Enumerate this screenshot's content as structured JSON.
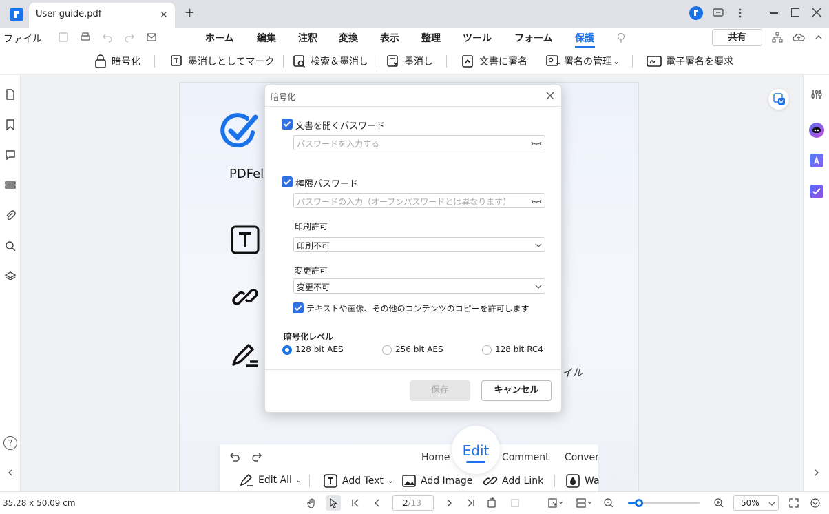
{
  "titlebar": {
    "tab_title": "User guide.pdf",
    "close": "✕",
    "new_tab": "+"
  },
  "menubar": {
    "file": "ファイル",
    "items": [
      "ホーム",
      "編集",
      "注釈",
      "変換",
      "表示",
      "整理",
      "ツール",
      "フォーム",
      "保護"
    ],
    "active": "保護",
    "share": "共有"
  },
  "ribbon": {
    "items": [
      "暗号化",
      "墨消しとしてマーク",
      "検索＆墨消し",
      "墨消し",
      "文書に署名",
      "署名の管理",
      "電子署名を要求"
    ],
    "manage_suffix": "⌄"
  },
  "page": {
    "brand": "PDFel",
    "stray_text": "イル"
  },
  "toolbar_preview": {
    "home": "Home",
    "edit": "Edit",
    "comment": "Comment",
    "convert": "Convert",
    "edit_all": "Edit All",
    "add_text": "Add Text",
    "add_image": "Add Image",
    "add_link": "Add Link",
    "wa": "Wa"
  },
  "dialog": {
    "title": "暗号化",
    "open_password_label": "文書を開くパスワード",
    "open_password_placeholder": "パスワードを入力する",
    "permission_password_label": "権限パスワード",
    "permission_password_placeholder": "パスワードの入力（オープンパスワードとは異なります）",
    "print_label": "印刷許可",
    "print_value": "印刷不可",
    "change_label": "変更許可",
    "change_value": "変更不可",
    "copy_label": "テキストや画像、その他のコンテンツのコピーを許可します",
    "level_label": "暗号化レベル",
    "levels": [
      "128 bit AES",
      "256 bit AES",
      "128 bit RC4"
    ],
    "selected_level": "128 bit AES",
    "save": "保存",
    "cancel": "キャンセル"
  },
  "statusbar": {
    "dimensions": "35.28 x 50.09 cm",
    "page_current": "2",
    "page_total": "/13",
    "zoom": "50%",
    "zoom_level": 0.15
  },
  "colors": {
    "accent": "#1a73e8",
    "checkbox": "#2f6fe0",
    "page_bg": "#f0f1f3"
  }
}
